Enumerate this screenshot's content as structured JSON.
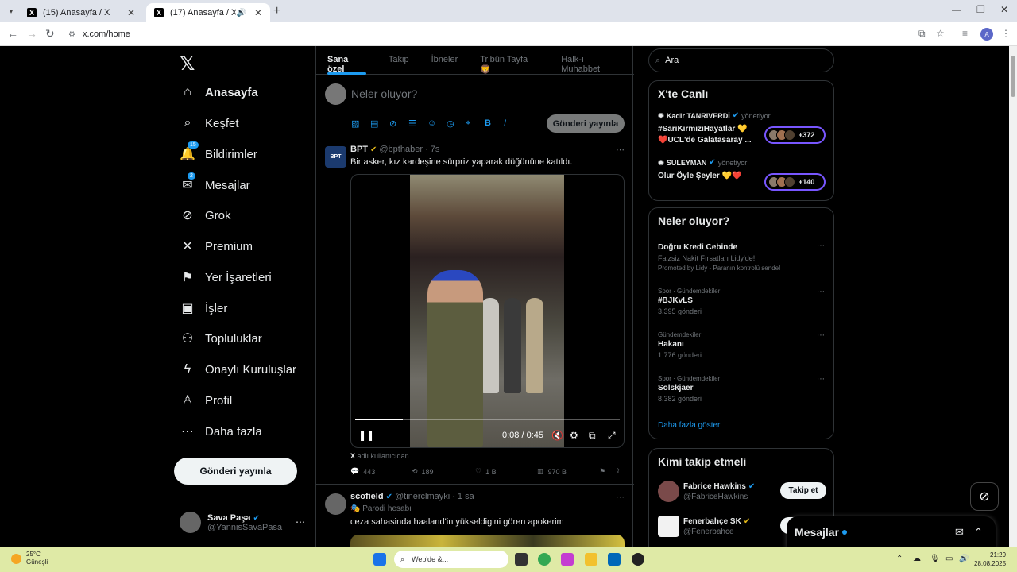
{
  "browser": {
    "tabs": [
      {
        "label": "(15) Anasayfa / X"
      },
      {
        "label": "(17) Anasayfa / X"
      }
    ],
    "url": "x.com/home"
  },
  "nav": {
    "items": [
      {
        "label": "Anasayfa",
        "icon": "home-icon"
      },
      {
        "label": "Keşfet",
        "icon": "search-icon"
      },
      {
        "label": "Bildirimler",
        "icon": "bell-icon",
        "badge": "15"
      },
      {
        "label": "Mesajlar",
        "icon": "mail-icon",
        "badge": "2"
      },
      {
        "label": "Grok",
        "icon": "grok-icon"
      },
      {
        "label": "Premium",
        "icon": "x-icon"
      },
      {
        "label": "Yer İşaretleri",
        "icon": "bookmark-icon"
      },
      {
        "label": "İşler",
        "icon": "briefcase-icon"
      },
      {
        "label": "Topluluklar",
        "icon": "people-icon"
      },
      {
        "label": "Onaylı Kuruluşlar",
        "icon": "lightning-icon"
      },
      {
        "label": "Profil",
        "icon": "person-icon"
      },
      {
        "label": "Daha fazla",
        "icon": "more-circle-icon"
      }
    ],
    "post_button": "Gönderi yayınla",
    "me": {
      "name": "Sava Paşa",
      "handle": "@YannisSavaPasa"
    }
  },
  "feed": {
    "tabs": [
      "Sana özel",
      "Takip",
      "İbneler",
      "Tribün Tayfa 🦁",
      "Halk-ı Muhabbet"
    ],
    "compose_placeholder": "Neler oluyor?",
    "compose_button": "Gönderi yayınla",
    "tweet1": {
      "name": "BPT",
      "handle": "@bpthaber",
      "time": "· 7s",
      "text": "Bir asker, kız kardeşine sürpriz yaparak düğününe katıldı.",
      "avatar_text": "BPT",
      "video_time": "0:08 / 0:45",
      "video_progress": 0.18,
      "source_x": "X",
      "source_text": "adlı kullanıcıdan",
      "replies": "443",
      "reposts": "189",
      "likes": "1 B",
      "views": "970 B"
    },
    "tweet2": {
      "name": "scofield",
      "handle": "@tinerclmayki",
      "time": "· 1 sa",
      "parody": "Parodi hesabı",
      "text": "ceza sahasinda haaland'in yükseldigini gören apokerim"
    }
  },
  "right": {
    "search_placeholder": "Ara",
    "live_title": "X'te Canlı",
    "live": [
      {
        "host": "Kadir TANRIVERDİ",
        "role": "yönetiyor",
        "title": "#SarıKırmızıHayatlar 💛❤️UCL'de Galatasaray ...",
        "count": "+372"
      },
      {
        "host": "SULEYMAN",
        "role": "yönetiyor",
        "title": "Olur Öyle Şeyler 💛❤️",
        "count": "+140"
      }
    ],
    "trends_title": "Neler oluyor?",
    "promo": {
      "name": "Doğru Kredi Cebinde",
      "sub": "Faizsiz Nakit Fırsatları Lidy'de!",
      "promo": "Promoted by Lidy - Paranın kontrolü sende!"
    },
    "trends": [
      {
        "cat": "Spor · Gündemdekiler",
        "name": "#BJKvLS",
        "sub": "3.395 gönderi"
      },
      {
        "cat": "Gündemdekiler",
        "name": "Hakanı",
        "sub": "1.776 gönderi"
      },
      {
        "cat": "Spor · Gündemdekiler",
        "name": "Solskjaer",
        "sub": "8.382 gönderi"
      }
    ],
    "show_more": "Daha fazla göster",
    "follow_title": "Kimi takip etmeli",
    "follow": [
      {
        "name": "Fabrice Hawkins",
        "handle": "@FabriceHawkins",
        "button": "Takip et"
      },
      {
        "name": "Fenerbahçe SK",
        "handle": "@Fenerbahce",
        "button": "Takip et"
      }
    ],
    "messages_dock": "Mesajlar"
  },
  "taskbar": {
    "temp": "25°C",
    "weather": "Güneşli",
    "search": "Web'de &...",
    "time": "21:29",
    "date": "28.08.2025"
  },
  "colors": {
    "accent": "#1d9bf0",
    "gold_check": "#e2b719",
    "live_border": "#7856ff"
  }
}
